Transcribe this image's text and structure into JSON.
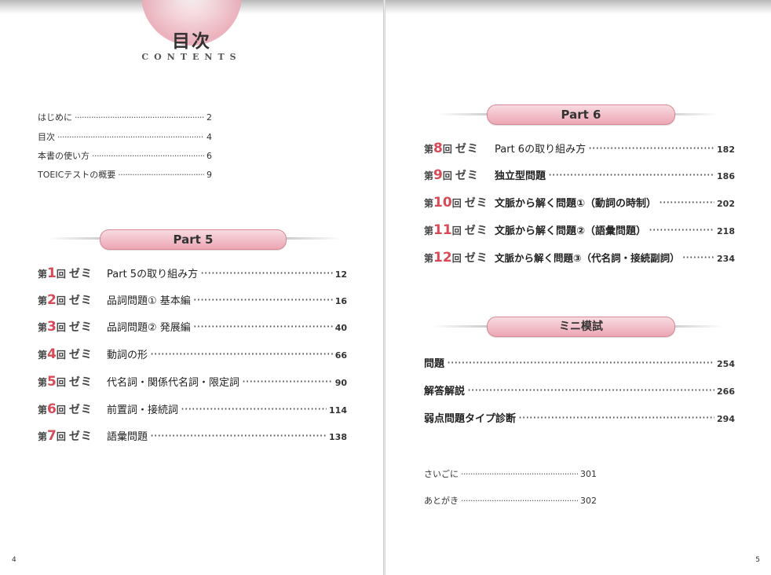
{
  "left": {
    "title": "目次",
    "subtitle": "CONTENTS",
    "intro": [
      {
        "label": "はじめに",
        "page": "2"
      },
      {
        "label": "目次",
        "page": "4"
      },
      {
        "label": "本書の使い方",
        "page": "6"
      },
      {
        "label": "TOEICテストの概要",
        "page": "9"
      }
    ],
    "part_label": "Part 5",
    "lessons": [
      {
        "prefix": "第",
        "num": "1",
        "kai": "回",
        "zemi": "ゼミ",
        "title": "Part 5の取り組み方",
        "page": "12"
      },
      {
        "prefix": "第",
        "num": "2",
        "kai": "回",
        "zemi": "ゼミ",
        "title": "品詞問題① 基本編",
        "page": "16"
      },
      {
        "prefix": "第",
        "num": "3",
        "kai": "回",
        "zemi": "ゼミ",
        "title": "品詞問題② 発展編",
        "page": "40"
      },
      {
        "prefix": "第",
        "num": "4",
        "kai": "回",
        "zemi": "ゼミ",
        "title": "動詞の形",
        "page": "66"
      },
      {
        "prefix": "第",
        "num": "5",
        "kai": "回",
        "zemi": "ゼミ",
        "title": "代名詞・関係代名詞・限定詞",
        "page": "90"
      },
      {
        "prefix": "第",
        "num": "6",
        "kai": "回",
        "zemi": "ゼミ",
        "title": "前置詞・接続詞",
        "page": "114"
      },
      {
        "prefix": "第",
        "num": "7",
        "kai": "回",
        "zemi": "ゼミ",
        "title": "語彙問題",
        "page": "138"
      }
    ],
    "folio": "4"
  },
  "right": {
    "part_label": "Part 6",
    "lessons": [
      {
        "prefix": "第",
        "num": "8",
        "kai": "回",
        "zemi": "ゼミ",
        "title": "Part 6の取り組み方",
        "page": "182"
      },
      {
        "prefix": "第",
        "num": "9",
        "kai": "回",
        "zemi": "ゼミ",
        "title": "独立型問題",
        "page": "186"
      },
      {
        "prefix": "第",
        "num": "10",
        "kai": "回",
        "zemi": "ゼミ",
        "title": "文脈から解く問題①（動詞の時制）",
        "page": "202"
      },
      {
        "prefix": "第",
        "num": "11",
        "kai": "回",
        "zemi": "ゼミ",
        "title": "文脈から解く問題②（語彙問題）",
        "page": "218"
      },
      {
        "prefix": "第",
        "num": "12",
        "kai": "回",
        "zemi": "ゼミ",
        "title": "文脈から解く問題③（代名詞・接続副詞）",
        "page": "234"
      }
    ],
    "mini_label": "ミニ模試",
    "mini_items": [
      {
        "label": "問題",
        "page": "254"
      },
      {
        "label": "解答解説",
        "page": "266"
      },
      {
        "label": "弱点問題タイプ診断",
        "page": "294"
      }
    ],
    "closing": [
      {
        "label": "さいごに",
        "page": "301"
      },
      {
        "label": "あとがき",
        "page": "302"
      }
    ],
    "folio": "5"
  }
}
